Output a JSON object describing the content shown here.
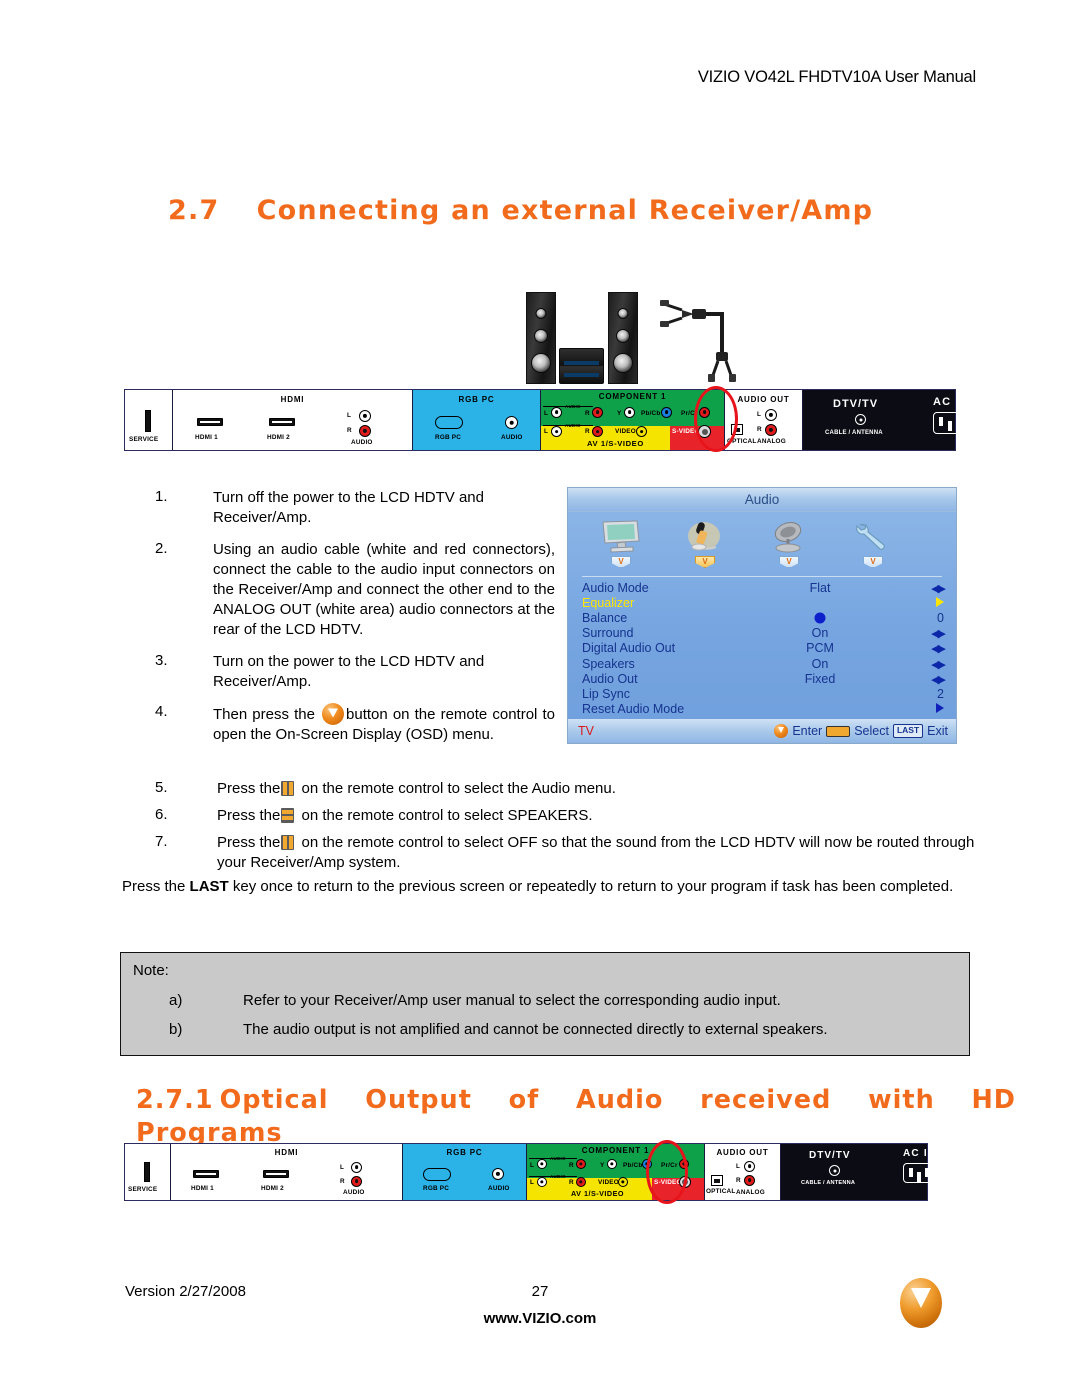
{
  "header": {
    "title": "VIZIO VO42L FHDTV10A User Manual"
  },
  "sections": {
    "s27": {
      "number": "2.7",
      "title": "Connecting an external Receiver/Amp"
    },
    "s271": {
      "number": "2.7.1",
      "words": [
        "Optical",
        "Output",
        "of",
        "Audio",
        "received",
        "with",
        "HD"
      ],
      "line2": "Programs"
    }
  },
  "illustration": {
    "speaker_left": "tower-speaker-left",
    "speaker_right": "tower-speaker-right",
    "amplifier": "receiver-amp-unit",
    "cable": "rca-audio-cable"
  },
  "panel": {
    "segments": [
      {
        "id": "service",
        "header": "",
        "color": "#ffffff",
        "labels": [
          "SERVICE"
        ]
      },
      {
        "id": "hdmi",
        "header": "HDMI",
        "color": "#ffffff",
        "labels": [
          "HDMI 1",
          "HDMI 2",
          "L",
          "R",
          "AUDIO"
        ]
      },
      {
        "id": "rgbpc",
        "header": "RGB PC",
        "color": "#2bb3e8",
        "labels": [
          "RGB PC",
          "AUDIO"
        ]
      },
      {
        "id": "component",
        "header": "COMPONENT 1",
        "color": "#0fa04a",
        "labels": [
          "L",
          "R",
          "AUDIO",
          "Y",
          "Pb/Cb",
          "Pr/Cr"
        ]
      },
      {
        "id": "av1",
        "header": "AV 1/S-VIDEO",
        "color": "#f5e400",
        "labels": [
          "L",
          "R",
          "AUDIO",
          "VIDEO",
          "S-VIDEO"
        ]
      },
      {
        "id": "audioout",
        "header": "AUDIO OUT",
        "color": "#ffffff",
        "labels": [
          "OPTICAL",
          "L",
          "R",
          "ANALOG"
        ]
      },
      {
        "id": "dtv",
        "header": "",
        "color": "#0c0c14",
        "labels": [
          "DTV/TV",
          "CABLE / ANTENNA",
          "AC IN"
        ]
      }
    ],
    "highlight_1": "analog-audio-out",
    "highlight_2": "optical-audio-out"
  },
  "steps": [
    {
      "n": "1.",
      "text": "Turn off the power to the LCD HDTV and Receiver/Amp."
    },
    {
      "n": "2.",
      "text": "Using an audio cable (white and red connectors), connect the cable to the audio input connectors on the Receiver/Amp and connect the other end to the ANALOG OUT (white area) audio connectors at the rear of the LCD HDTV."
    },
    {
      "n": "3.",
      "text": "Turn on the power to the LCD HDTV and Receiver/Amp."
    },
    {
      "n": "4.",
      "pre": "Then press the ",
      "post": "button on the remote control to open the On-Screen Display (OSD) menu.",
      "icon": "vizio-v-button"
    },
    {
      "n": "5.",
      "pre": "Press the",
      "post": " on the remote control to select the Audio menu.",
      "icon": "left-right-arrow-key"
    },
    {
      "n": "6.",
      "pre": "Press the",
      "post": " on the remote control to select SPEAKERS.",
      "icon": "up-down-arrow-key"
    },
    {
      "n": "7.",
      "pre": "Press the",
      "post": " on the remote control to select OFF so that the sound from the LCD HDTV will now be routed through your Receiver/Amp system.",
      "icon": "left-right-arrow-key"
    }
  ],
  "last_paragraph": {
    "pre": "Press the ",
    "key": "LAST",
    "post": " key once to return to the previous screen or repeatedly to return to your program if task has been completed."
  },
  "note": {
    "title": "Note:",
    "items": [
      {
        "letter": "a)",
        "text": "Refer to your Receiver/Amp user manual to select the corresponding audio input."
      },
      {
        "letter": "b)",
        "text": "The audio output is not amplified and cannot be connected directly to external speakers."
      }
    ]
  },
  "osd": {
    "title": "Audio",
    "icons": [
      {
        "name": "picture-monitor-icon",
        "tag": "V",
        "selected": false
      },
      {
        "name": "audio-microphone-icon",
        "tag": "V",
        "selected": true
      },
      {
        "name": "tuner-satellite-icon",
        "tag": "V",
        "selected": false
      },
      {
        "name": "setup-wrench-icon",
        "tag": "V",
        "selected": false
      }
    ],
    "rows": [
      {
        "label": "Audio Mode",
        "value": "Flat",
        "control": "lr",
        "highlight": false
      },
      {
        "label": "Equalizer",
        "value": "",
        "control": "tri-yellow",
        "highlight": true
      },
      {
        "label": "Balance",
        "value": "",
        "control": "slider-knob",
        "right": "0",
        "fill": 50
      },
      {
        "label": "Surround",
        "value": "On",
        "control": "lr",
        "highlight": false
      },
      {
        "label": "Digital Audio Out",
        "value": "PCM",
        "control": "lr",
        "highlight": false
      },
      {
        "label": "Speakers",
        "value": "On",
        "control": "lr",
        "highlight": false
      },
      {
        "label": "Audio Out",
        "value": "Fixed",
        "control": "lr",
        "highlight": false
      },
      {
        "label": "Lip Sync",
        "value": "",
        "control": "slider-fill",
        "right": "2",
        "fill": 42
      },
      {
        "label": "Reset Audio Mode",
        "value": "",
        "control": "tri-blue",
        "highlight": false
      }
    ],
    "footer": {
      "source": "TV",
      "enter": "Enter",
      "select": "Select",
      "last": "LAST",
      "exit": "Exit"
    }
  },
  "footer": {
    "version": "Version 2/27/2008",
    "page": "27",
    "site": "www.VIZIO.com",
    "logo": "vizio-logo"
  }
}
